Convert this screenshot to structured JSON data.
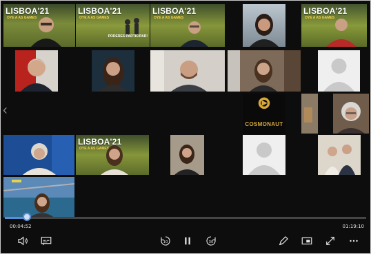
{
  "banner": {
    "title": "LISBOA'21",
    "subtitle": "OYE A AS GAMES",
    "cta": "PODERES PARTICIPAR!"
  },
  "cosmonaut": {
    "label": "COSMONAUT"
  },
  "player": {
    "elapsed": "00:04:52",
    "duration": "01:19:10",
    "progress_fraction": 0.061
  },
  "controls": [
    {
      "name": "volume-icon"
    },
    {
      "name": "captions-icon"
    },
    {
      "name": "rewind-10-icon",
      "label": "10"
    },
    {
      "name": "pause-icon"
    },
    {
      "name": "forward-30-icon",
      "label": "30"
    },
    {
      "name": "pencil-icon"
    },
    {
      "name": "picture-in-picture-icon"
    },
    {
      "name": "fullscreen-icon"
    },
    {
      "name": "more-icon"
    }
  ],
  "colors": {
    "accent": "#5a8dd6",
    "banner_green": "#5f7a2f",
    "cosmonaut_gold": "#d8a93a"
  }
}
